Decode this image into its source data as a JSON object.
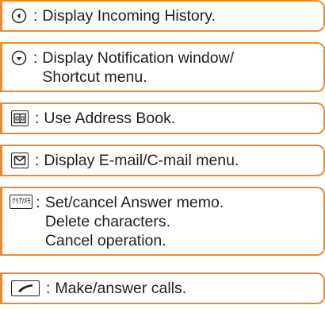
{
  "items": [
    {
      "icon": "nav-left-circle-icon",
      "lines": [
        "Display Incoming History."
      ]
    },
    {
      "icon": "nav-down-circle-icon",
      "lines": [
        "Display Notification window/",
        "Shortcut menu."
      ]
    },
    {
      "icon": "address-book-key-icon",
      "lines": [
        "Use Address Book."
      ]
    },
    {
      "icon": "mail-key-icon",
      "lines": [
        "Display E-mail/C-mail menu."
      ]
    },
    {
      "icon": "clear-memo-key-icon",
      "key_text": "ｸﾘｱ/ﾒﾓ",
      "lines": [
        "Set/cancel Answer memo.",
        "Delete characters.",
        "Cancel operation."
      ]
    },
    {
      "icon": "call-key-icon",
      "lines": [
        "Make/answer calls."
      ]
    }
  ],
  "separator": ":",
  "colors": {
    "border": "#ef8a2c",
    "text": "#1f1f1f"
  }
}
